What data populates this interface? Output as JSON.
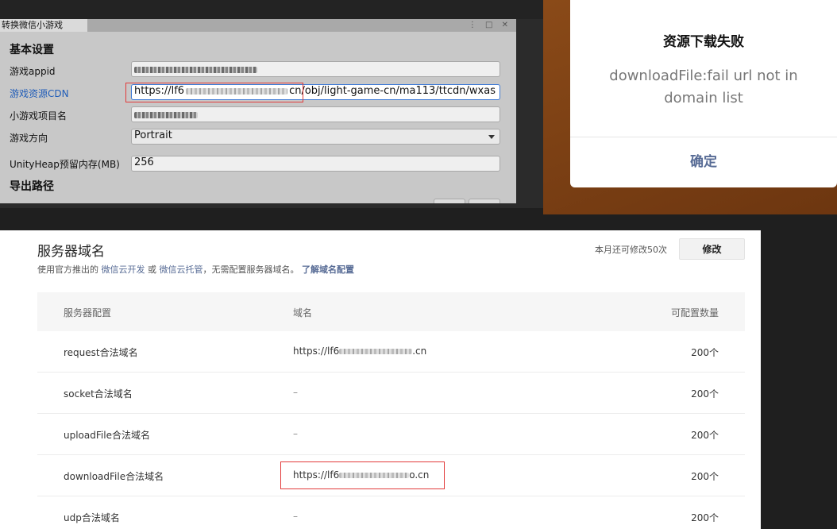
{
  "editor": {
    "tab_title": "转换微信小游戏",
    "section_basic": "基本设置",
    "section_export": "导出路径",
    "fields": {
      "appid_label": "游戏appid",
      "cdn_label": "游戏资源CDN",
      "cdn_value_prefix": "https://lf6",
      "cdn_value_suffix": "cn/obj/light-game-cn/ma113/ttcdn/wxas",
      "project_label": "小游戏项目名",
      "orientation_label": "游戏方向",
      "orientation_value": "Portrait",
      "heap_label": "UnityHeap预留内存(MB)",
      "heap_value": "256"
    }
  },
  "dialog": {
    "title": "资源下载失败",
    "message": "downloadFile:fail url not in domain list",
    "ok_label": "确定",
    "ok_color": "#576b95"
  },
  "domains": {
    "title": "服务器域名",
    "desc_prefix": "使用官方推出的",
    "link_cloud_dev": "微信云开发",
    "desc_or": "或",
    "link_cloud_host": "微信云托管",
    "desc_suffix": "，无需配置服务器域名。",
    "link_learn": "了解域名配置",
    "remaining": "本月还可修改50次",
    "modify_label": "修改",
    "headers": {
      "config": "服务器配置",
      "domain": "域名",
      "count": "可配置数量"
    },
    "rows": [
      {
        "name": "request合法域名",
        "domain_prefix": "https://lf6",
        "domain_suffix": ".cn",
        "count": "200个"
      },
      {
        "name": "socket合法域名",
        "domain": "–",
        "count": "200个"
      },
      {
        "name": "uploadFile合法域名",
        "domain": "–",
        "count": "200个"
      },
      {
        "name": "downloadFile合法域名",
        "domain_prefix": "https://lf6",
        "domain_suffix": "o.cn",
        "count": "200个"
      },
      {
        "name": "udp合法域名",
        "domain": "–",
        "count": "200个"
      }
    ],
    "highlight_color": "#e23b3b"
  }
}
